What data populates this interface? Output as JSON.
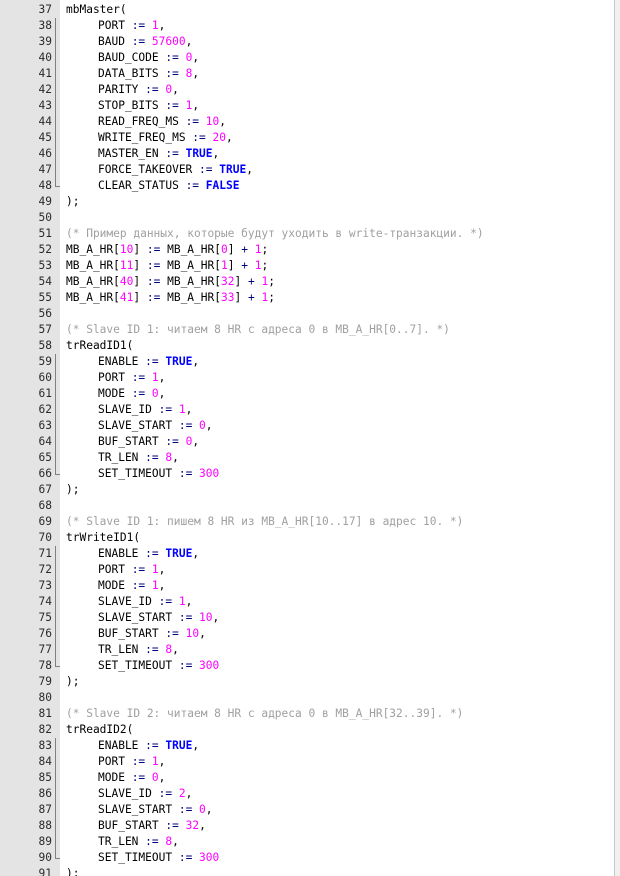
{
  "colors": {
    "gutter": "#e4e4e4",
    "number": "#ff00ff",
    "keyword": "#0000ff",
    "comment": "#a0a0a0",
    "operator": "#000080",
    "text": "#000000"
  },
  "lines": [
    {
      "n": "37",
      "ind": 0,
      "fold": "start",
      "t": [
        [
          "id",
          "mbMaster"
        ],
        [
          "pn",
          "("
        ]
      ]
    },
    {
      "n": "38",
      "ind": 1,
      "t": [
        [
          "id",
          "PORT"
        ],
        [
          "op",
          " := "
        ],
        [
          "num",
          "1"
        ],
        [
          "pn",
          ","
        ]
      ]
    },
    {
      "n": "39",
      "ind": 1,
      "t": [
        [
          "id",
          "BAUD"
        ],
        [
          "op",
          " := "
        ],
        [
          "num",
          "57600"
        ],
        [
          "pn",
          ","
        ]
      ]
    },
    {
      "n": "40",
      "ind": 1,
      "t": [
        [
          "id",
          "BAUD_CODE"
        ],
        [
          "op",
          " := "
        ],
        [
          "num",
          "0"
        ],
        [
          "pn",
          ","
        ]
      ]
    },
    {
      "n": "41",
      "ind": 1,
      "t": [
        [
          "id",
          "DATA_BITS"
        ],
        [
          "op",
          " := "
        ],
        [
          "num",
          "8"
        ],
        [
          "pn",
          ","
        ]
      ]
    },
    {
      "n": "42",
      "ind": 1,
      "t": [
        [
          "id",
          "PARITY"
        ],
        [
          "op",
          " := "
        ],
        [
          "num",
          "0"
        ],
        [
          "pn",
          ","
        ]
      ]
    },
    {
      "n": "43",
      "ind": 1,
      "t": [
        [
          "id",
          "STOP_BITS"
        ],
        [
          "op",
          " := "
        ],
        [
          "num",
          "1"
        ],
        [
          "pn",
          ","
        ]
      ]
    },
    {
      "n": "44",
      "ind": 1,
      "t": [
        [
          "id",
          "READ_FREQ_MS"
        ],
        [
          "op",
          " := "
        ],
        [
          "num",
          "10"
        ],
        [
          "pn",
          ","
        ]
      ]
    },
    {
      "n": "45",
      "ind": 1,
      "t": [
        [
          "id",
          "WRITE_FREQ_MS"
        ],
        [
          "op",
          " := "
        ],
        [
          "num",
          "20"
        ],
        [
          "pn",
          ","
        ]
      ]
    },
    {
      "n": "46",
      "ind": 1,
      "t": [
        [
          "id",
          "MASTER_EN"
        ],
        [
          "op",
          " := "
        ],
        [
          "kw",
          "TRUE"
        ],
        [
          "pn",
          ","
        ]
      ]
    },
    {
      "n": "47",
      "ind": 1,
      "t": [
        [
          "id",
          "FORCE_TAKEOVER"
        ],
        [
          "op",
          " := "
        ],
        [
          "kw",
          "TRUE"
        ],
        [
          "pn",
          ","
        ]
      ]
    },
    {
      "n": "48",
      "ind": 1,
      "fold": "end",
      "t": [
        [
          "id",
          "CLEAR_STATUS"
        ],
        [
          "op",
          " := "
        ],
        [
          "kw",
          "FALSE"
        ]
      ]
    },
    {
      "n": "49",
      "ind": 0,
      "t": [
        [
          "pn",
          ");"
        ]
      ]
    },
    {
      "n": "50",
      "ind": 0,
      "t": []
    },
    {
      "n": "51",
      "ind": 0,
      "t": [
        [
          "cm",
          "(* Пример данных, которые будут уходить в write-транзакции. *)"
        ]
      ]
    },
    {
      "n": "52",
      "ind": 0,
      "t": [
        [
          "id",
          "MB_A_HR"
        ],
        [
          "pn",
          "["
        ],
        [
          "num",
          "10"
        ],
        [
          "pn",
          "]"
        ],
        [
          "op",
          " := "
        ],
        [
          "id",
          "MB_A_HR"
        ],
        [
          "pn",
          "["
        ],
        [
          "num",
          "0"
        ],
        [
          "pn",
          "]"
        ],
        [
          "op",
          " + "
        ],
        [
          "num",
          "1"
        ],
        [
          "pn",
          ";"
        ]
      ]
    },
    {
      "n": "53",
      "ind": 0,
      "t": [
        [
          "id",
          "MB_A_HR"
        ],
        [
          "pn",
          "["
        ],
        [
          "num",
          "11"
        ],
        [
          "pn",
          "]"
        ],
        [
          "op",
          " := "
        ],
        [
          "id",
          "MB_A_HR"
        ],
        [
          "pn",
          "["
        ],
        [
          "num",
          "1"
        ],
        [
          "pn",
          "]"
        ],
        [
          "op",
          " + "
        ],
        [
          "num",
          "1"
        ],
        [
          "pn",
          ";"
        ]
      ]
    },
    {
      "n": "54",
      "ind": 0,
      "t": [
        [
          "id",
          "MB_A_HR"
        ],
        [
          "pn",
          "["
        ],
        [
          "num",
          "40"
        ],
        [
          "pn",
          "]"
        ],
        [
          "op",
          " := "
        ],
        [
          "id",
          "MB_A_HR"
        ],
        [
          "pn",
          "["
        ],
        [
          "num",
          "32"
        ],
        [
          "pn",
          "]"
        ],
        [
          "op",
          " + "
        ],
        [
          "num",
          "1"
        ],
        [
          "pn",
          ";"
        ]
      ]
    },
    {
      "n": "55",
      "ind": 0,
      "t": [
        [
          "id",
          "MB_A_HR"
        ],
        [
          "pn",
          "["
        ],
        [
          "num",
          "41"
        ],
        [
          "pn",
          "]"
        ],
        [
          "op",
          " := "
        ],
        [
          "id",
          "MB_A_HR"
        ],
        [
          "pn",
          "["
        ],
        [
          "num",
          "33"
        ],
        [
          "pn",
          "]"
        ],
        [
          "op",
          " + "
        ],
        [
          "num",
          "1"
        ],
        [
          "pn",
          ";"
        ]
      ]
    },
    {
      "n": "56",
      "ind": 0,
      "t": []
    },
    {
      "n": "57",
      "ind": 0,
      "t": [
        [
          "cm",
          "(* Slave ID 1: читаем 8 HR с адреса 0 в MB_A_HR[0..7]. *)"
        ]
      ]
    },
    {
      "n": "58",
      "ind": 0,
      "fold": "start",
      "t": [
        [
          "id",
          "trReadID1"
        ],
        [
          "pn",
          "("
        ]
      ]
    },
    {
      "n": "59",
      "ind": 1,
      "t": [
        [
          "id",
          "ENABLE"
        ],
        [
          "op",
          " := "
        ],
        [
          "kw",
          "TRUE"
        ],
        [
          "pn",
          ","
        ]
      ]
    },
    {
      "n": "60",
      "ind": 1,
      "t": [
        [
          "id",
          "PORT"
        ],
        [
          "op",
          " := "
        ],
        [
          "num",
          "1"
        ],
        [
          "pn",
          ","
        ]
      ]
    },
    {
      "n": "61",
      "ind": 1,
      "t": [
        [
          "id",
          "MODE"
        ],
        [
          "op",
          " := "
        ],
        [
          "num",
          "0"
        ],
        [
          "pn",
          ","
        ]
      ]
    },
    {
      "n": "62",
      "ind": 1,
      "t": [
        [
          "id",
          "SLAVE_ID"
        ],
        [
          "op",
          " := "
        ],
        [
          "num",
          "1"
        ],
        [
          "pn",
          ","
        ]
      ]
    },
    {
      "n": "63",
      "ind": 1,
      "t": [
        [
          "id",
          "SLAVE_START"
        ],
        [
          "op",
          " := "
        ],
        [
          "num",
          "0"
        ],
        [
          "pn",
          ","
        ]
      ]
    },
    {
      "n": "64",
      "ind": 1,
      "t": [
        [
          "id",
          "BUF_START"
        ],
        [
          "op",
          " := "
        ],
        [
          "num",
          "0"
        ],
        [
          "pn",
          ","
        ]
      ]
    },
    {
      "n": "65",
      "ind": 1,
      "t": [
        [
          "id",
          "TR_LEN"
        ],
        [
          "op",
          " := "
        ],
        [
          "num",
          "8"
        ],
        [
          "pn",
          ","
        ]
      ]
    },
    {
      "n": "66",
      "ind": 1,
      "fold": "end",
      "t": [
        [
          "id",
          "SET_TIMEOUT"
        ],
        [
          "op",
          " := "
        ],
        [
          "num",
          "300"
        ]
      ]
    },
    {
      "n": "67",
      "ind": 0,
      "t": [
        [
          "pn",
          ");"
        ]
      ]
    },
    {
      "n": "68",
      "ind": 0,
      "t": []
    },
    {
      "n": "69",
      "ind": 0,
      "t": [
        [
          "cm",
          "(* Slave ID 1: пишем 8 HR из MB_A_HR[10..17] в адрес 10. *)"
        ]
      ]
    },
    {
      "n": "70",
      "ind": 0,
      "fold": "start",
      "t": [
        [
          "id",
          "trWriteID1"
        ],
        [
          "pn",
          "("
        ]
      ]
    },
    {
      "n": "71",
      "ind": 1,
      "t": [
        [
          "id",
          "ENABLE"
        ],
        [
          "op",
          " := "
        ],
        [
          "kw",
          "TRUE"
        ],
        [
          "pn",
          ","
        ]
      ]
    },
    {
      "n": "72",
      "ind": 1,
      "t": [
        [
          "id",
          "PORT"
        ],
        [
          "op",
          " := "
        ],
        [
          "num",
          "1"
        ],
        [
          "pn",
          ","
        ]
      ]
    },
    {
      "n": "73",
      "ind": 1,
      "t": [
        [
          "id",
          "MODE"
        ],
        [
          "op",
          " := "
        ],
        [
          "num",
          "1"
        ],
        [
          "pn",
          ","
        ]
      ]
    },
    {
      "n": "74",
      "ind": 1,
      "t": [
        [
          "id",
          "SLAVE_ID"
        ],
        [
          "op",
          " := "
        ],
        [
          "num",
          "1"
        ],
        [
          "pn",
          ","
        ]
      ]
    },
    {
      "n": "75",
      "ind": 1,
      "t": [
        [
          "id",
          "SLAVE_START"
        ],
        [
          "op",
          " := "
        ],
        [
          "num",
          "10"
        ],
        [
          "pn",
          ","
        ]
      ]
    },
    {
      "n": "76",
      "ind": 1,
      "t": [
        [
          "id",
          "BUF_START"
        ],
        [
          "op",
          " := "
        ],
        [
          "num",
          "10"
        ],
        [
          "pn",
          ","
        ]
      ]
    },
    {
      "n": "77",
      "ind": 1,
      "t": [
        [
          "id",
          "TR_LEN"
        ],
        [
          "op",
          " := "
        ],
        [
          "num",
          "8"
        ],
        [
          "pn",
          ","
        ]
      ]
    },
    {
      "n": "78",
      "ind": 1,
      "fold": "end",
      "t": [
        [
          "id",
          "SET_TIMEOUT"
        ],
        [
          "op",
          " := "
        ],
        [
          "num",
          "300"
        ]
      ]
    },
    {
      "n": "79",
      "ind": 0,
      "t": [
        [
          "pn",
          ");"
        ]
      ]
    },
    {
      "n": "80",
      "ind": 0,
      "t": []
    },
    {
      "n": "81",
      "ind": 0,
      "t": [
        [
          "cm",
          "(* Slave ID 2: читаем 8 HR с адреса 0 в MB_A_HR[32..39]. *)"
        ]
      ]
    },
    {
      "n": "82",
      "ind": 0,
      "fold": "start",
      "t": [
        [
          "id",
          "trReadID2"
        ],
        [
          "pn",
          "("
        ]
      ]
    },
    {
      "n": "83",
      "ind": 1,
      "t": [
        [
          "id",
          "ENABLE"
        ],
        [
          "op",
          " := "
        ],
        [
          "kw",
          "TRUE"
        ],
        [
          "pn",
          ","
        ]
      ]
    },
    {
      "n": "84",
      "ind": 1,
      "t": [
        [
          "id",
          "PORT"
        ],
        [
          "op",
          " := "
        ],
        [
          "num",
          "1"
        ],
        [
          "pn",
          ","
        ]
      ]
    },
    {
      "n": "85",
      "ind": 1,
      "t": [
        [
          "id",
          "MODE"
        ],
        [
          "op",
          " := "
        ],
        [
          "num",
          "0"
        ],
        [
          "pn",
          ","
        ]
      ]
    },
    {
      "n": "86",
      "ind": 1,
      "t": [
        [
          "id",
          "SLAVE_ID"
        ],
        [
          "op",
          " := "
        ],
        [
          "num",
          "2"
        ],
        [
          "pn",
          ","
        ]
      ]
    },
    {
      "n": "87",
      "ind": 1,
      "t": [
        [
          "id",
          "SLAVE_START"
        ],
        [
          "op",
          " := "
        ],
        [
          "num",
          "0"
        ],
        [
          "pn",
          ","
        ]
      ]
    },
    {
      "n": "88",
      "ind": 1,
      "t": [
        [
          "id",
          "BUF_START"
        ],
        [
          "op",
          " := "
        ],
        [
          "num",
          "32"
        ],
        [
          "pn",
          ","
        ]
      ]
    },
    {
      "n": "89",
      "ind": 1,
      "t": [
        [
          "id",
          "TR_LEN"
        ],
        [
          "op",
          " := "
        ],
        [
          "num",
          "8"
        ],
        [
          "pn",
          ","
        ]
      ]
    },
    {
      "n": "90",
      "ind": 1,
      "fold": "end",
      "t": [
        [
          "id",
          "SET_TIMEOUT"
        ],
        [
          "op",
          " := "
        ],
        [
          "num",
          "300"
        ]
      ]
    },
    {
      "n": "91",
      "ind": 0,
      "t": [
        [
          "pn",
          ");"
        ]
      ]
    }
  ]
}
